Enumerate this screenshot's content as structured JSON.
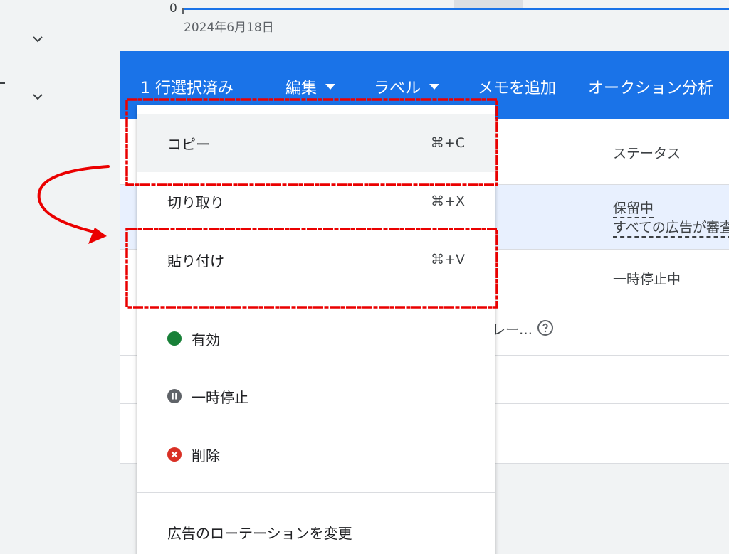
{
  "chart": {
    "y_zero_label": "0",
    "x_date_label": "2024年6月18日"
  },
  "selection_bar": {
    "selected_count_label": "1 行選択済み",
    "edit_label": "編集",
    "label_label": "ラベル",
    "add_note_label": "メモを追加",
    "auction_label": "オークション分析"
  },
  "table": {
    "status_header": "ステータス",
    "rows": [
      {
        "status": "保留中",
        "status_detail": "すべての広告が審査中"
      },
      {
        "status": "一時停止中"
      },
      {
        "truncated_text": "レー…"
      }
    ]
  },
  "context_menu": {
    "items": [
      {
        "label": "コピー",
        "shortcut": "⌘+C"
      },
      {
        "label": "切り取り",
        "shortcut": "⌘+X"
      },
      {
        "label": "貼り付け",
        "shortcut": "⌘+V"
      },
      {
        "label": "有効",
        "status_color": "#188038",
        "icon": "enabled-dot-icon"
      },
      {
        "label": "一時停止",
        "status_color": "#5f6368",
        "icon": "pause-circle-icon"
      },
      {
        "label": "削除",
        "status_color": "#d93025",
        "icon": "remove-circle-icon"
      },
      {
        "label": "広告のローテーションを変更"
      }
    ]
  },
  "colors": {
    "accent": "#1a73e8",
    "highlight_row": "#e8f0fe",
    "annotation": "#ea0000"
  }
}
